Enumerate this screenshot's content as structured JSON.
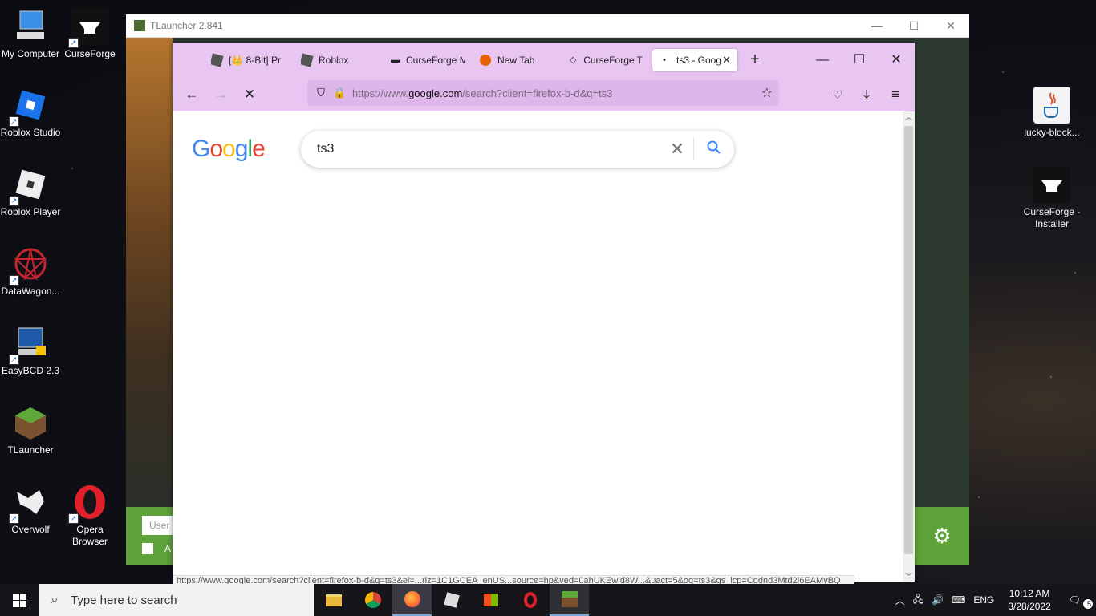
{
  "desktop": {
    "left_icons": [
      {
        "label": "My Computer"
      },
      {
        "label": "CurseForge"
      },
      {
        "label": "Roblox Studio"
      },
      {
        "label": "Roblox Player"
      },
      {
        "label": "DataWagon..."
      },
      {
        "label": "EasyBCD 2.3"
      },
      {
        "label": "TLauncher"
      },
      {
        "label": "Overwolf"
      },
      {
        "label": "Opera Browser"
      }
    ],
    "right_icons": [
      {
        "label": "lucky-block..."
      },
      {
        "label": "CurseForge - Installer"
      }
    ]
  },
  "tlauncher": {
    "title": "TLauncher 2.841",
    "user_placeholder": "User",
    "checkbox_label": "A"
  },
  "browser": {
    "tabs": [
      {
        "label": "[👑 8-Bit] Pr",
        "icon": "roblox-icon"
      },
      {
        "label": "Roblox",
        "icon": "roblox-icon"
      },
      {
        "label": "CurseForge M",
        "icon": "anvil-icon"
      },
      {
        "label": "New Tab",
        "icon": "firefox-icon"
      },
      {
        "label": "CurseForge T",
        "icon": "anvil-outline-icon"
      },
      {
        "label": "ts3 - Goog",
        "icon": "loading-dot-icon",
        "active": true
      }
    ],
    "url_prefix": "https://www.",
    "url_domain": "google.com",
    "url_suffix": "/search?client=firefox-b-d&q=ts3",
    "status_text": "https://www.google.com/search?client=firefox-b-d&q=ts3&ei=...rlz=1C1GCEA_enUS...source=hp&ved=0ahUKEwjd8W...&uact=5&oq=ts3&gs_lcp=Cgdnd3Mtd2l6EAMyBQ"
  },
  "google": {
    "logo": "Google",
    "query": "ts3"
  },
  "taskbar": {
    "search_placeholder": "Type here to search",
    "lang": "ENG",
    "time": "10:12 AM",
    "date": "3/28/2022",
    "notification_count": "5"
  }
}
